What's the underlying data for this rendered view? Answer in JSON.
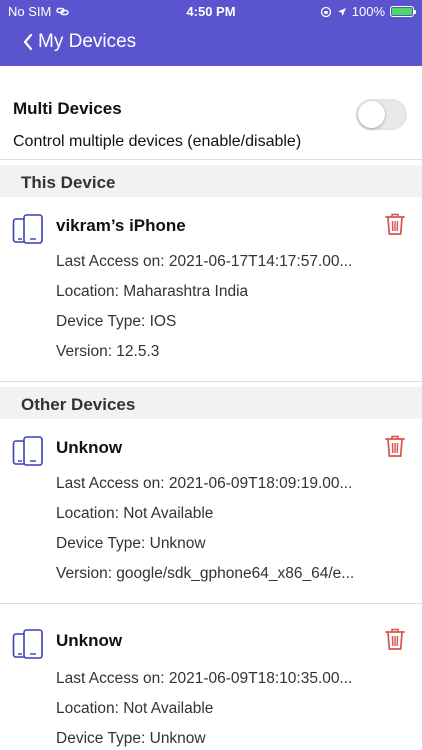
{
  "status_bar": {
    "carrier": "No SIM",
    "time": "4:50 PM",
    "battery": "100%",
    "battery_level": 1.0,
    "colors": {
      "bar": "#5a55cf",
      "battery_fill": "#4cd964"
    }
  },
  "nav": {
    "title": "My Devices",
    "back_icon": "chevron-left-icon"
  },
  "multi_devices": {
    "title": "Multi Devices",
    "description": "Control multiple devices (enable/disable)",
    "enabled": false
  },
  "sections": {
    "this_device": "This Device",
    "other_devices": "Other Devices"
  },
  "this_device": {
    "name": "vikram’s iPhone",
    "last_access": "Last Access on: 2021-06-17T14:17:57.00...",
    "location": "Location: Maharashtra India",
    "device_type": "Device Type: IOS",
    "version": "Version: 12.5.3"
  },
  "other_devices": [
    {
      "name": "Unknow",
      "last_access": "Last Access on: 2021-06-09T18:09:19.00...",
      "location": "Location: Not Available",
      "device_type": "Device Type: Unknow",
      "version": "Version: google/sdk_gphone64_x86_64/e..."
    },
    {
      "name": "Unknow",
      "last_access": "Last Access on: 2021-06-09T18:10:35.00...",
      "location": "Location: Not Available",
      "device_type": "Device Type: Unknow"
    }
  ],
  "icons": {
    "device": "devices-icon",
    "delete": "trash-icon"
  },
  "colors": {
    "accent": "#5a55cf",
    "delete": "#d9534f",
    "device_icon": "#3b3fb5"
  }
}
